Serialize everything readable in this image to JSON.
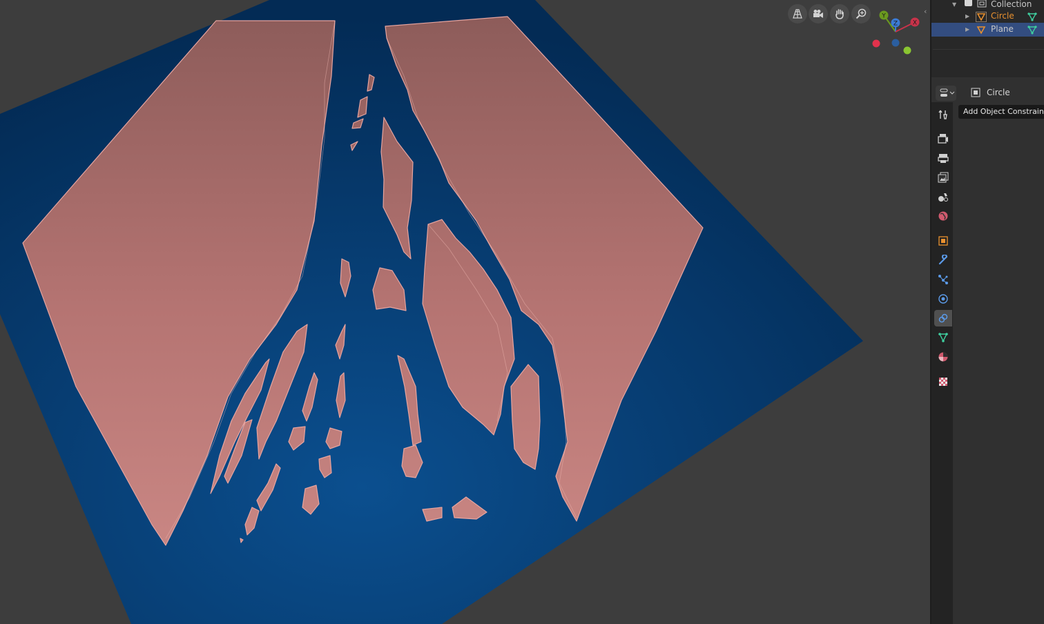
{
  "viewport": {
    "nav_buttons": [
      {
        "icon": "perspective-grid-icon"
      },
      {
        "icon": "camera-icon"
      },
      {
        "icon": "hand-pan-icon"
      },
      {
        "icon": "zoom-icon"
      }
    ],
    "gizmo": {
      "y": "Y",
      "z": "Z",
      "x": "X"
    },
    "colors": {
      "plane": "#0b4a86",
      "mesh": "#cf7f75",
      "background": "#3d3d3d"
    }
  },
  "outliner": {
    "rows": [
      {
        "label": "Collection",
        "icon": "collection-icon"
      },
      {
        "label": "Circle",
        "icon": "mesh-object-icon",
        "active": true
      },
      {
        "label": "Plane",
        "icon": "mesh-object-icon",
        "selected": true
      }
    ]
  },
  "properties": {
    "context_object": "Circle",
    "tooltip": "Add Object Constraint",
    "tabs": [
      {
        "icon": "tool-icon"
      },
      {
        "icon": "render-icon"
      },
      {
        "icon": "output-icon"
      },
      {
        "icon": "view-layer-icon"
      },
      {
        "icon": "scene-icon"
      },
      {
        "icon": "world-icon"
      },
      {
        "icon": "object-icon"
      },
      {
        "icon": "modifier-icon"
      },
      {
        "icon": "particles-icon"
      },
      {
        "icon": "physics-icon"
      },
      {
        "icon": "constraint-icon",
        "active": true
      },
      {
        "icon": "data-icon"
      },
      {
        "icon": "material-icon"
      },
      {
        "icon": "texture-icon"
      }
    ]
  }
}
